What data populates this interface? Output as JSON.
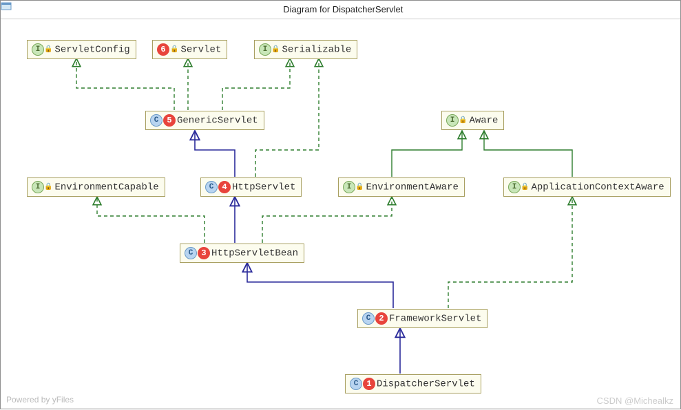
{
  "title": "Diagram for DispatcherServlet",
  "powered": "Powered by yFiles",
  "watermark": "CSDN @Michealkz",
  "nodes": {
    "servletConfig": {
      "kind": "I",
      "num": null,
      "label": "ServletConfig"
    },
    "servlet": {
      "kind": "I",
      "num": "6",
      "label": "Servlet"
    },
    "serializable": {
      "kind": "I",
      "num": null,
      "label": "Serializable"
    },
    "genericServlet": {
      "kind": "C",
      "num": "5",
      "label": "GenericServlet"
    },
    "aware": {
      "kind": "I",
      "num": null,
      "label": "Aware"
    },
    "envCapable": {
      "kind": "I",
      "num": null,
      "label": "EnvironmentCapable"
    },
    "httpServlet": {
      "kind": "C",
      "num": "4",
      "label": "HttpServlet"
    },
    "envAware": {
      "kind": "I",
      "num": null,
      "label": "EnvironmentAware"
    },
    "appCtxAware": {
      "kind": "I",
      "num": null,
      "label": "ApplicationContextAware"
    },
    "httpServletBean": {
      "kind": "C",
      "num": "3",
      "label": "HttpServletBean"
    },
    "frameworkServlet": {
      "kind": "C",
      "num": "2",
      "label": "FrameworkServlet"
    },
    "dispatcherServlet": {
      "kind": "C",
      "num": "1",
      "label": "DispatcherServlet"
    }
  }
}
